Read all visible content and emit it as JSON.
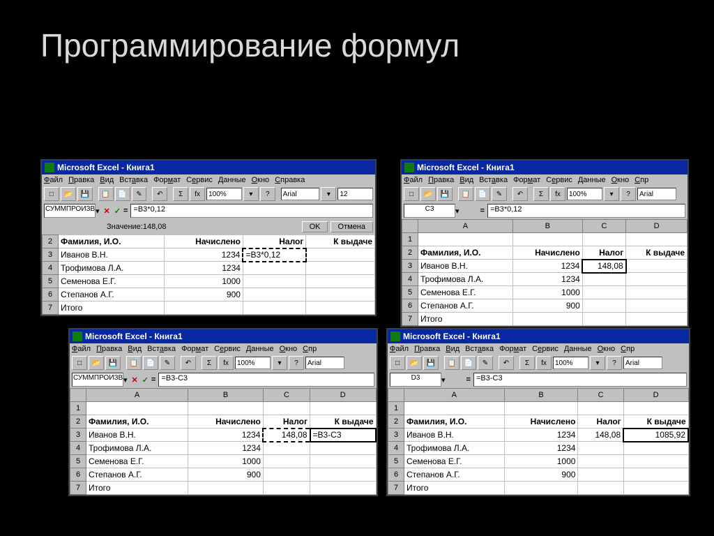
{
  "title": "Программирование формул",
  "app": "Microsoft Excel - Книга1",
  "menu": [
    "Файл",
    "Правка",
    "Вид",
    "Вставка",
    "Формат",
    "Сервис",
    "Данные",
    "Окно",
    "Справка"
  ],
  "underline": [
    "Ф",
    "П",
    "В",
    "",
    "",
    "",
    "Д",
    "О",
    "Спр"
  ],
  "zoom": "100%",
  "font": "Arial",
  "fsize": "12",
  "cols": [
    "A",
    "B",
    "C",
    "D"
  ],
  "headers": [
    "Фамилия, И.О.",
    "Начислено",
    "Налог",
    "К выдаче"
  ],
  "names": [
    "Иванов В.Н.",
    "Трофимова Л.А.",
    "Семенова Е.Г.",
    "Степанов А.Г.",
    "Итого"
  ],
  "vals": [
    "1234",
    "1234",
    "1000",
    "900"
  ],
  "w1": {
    "namebox": "СУММПРОИЗВ",
    "formula": "=B3*0,12",
    "valLabel": "Значение:148,08",
    "ok": "OK",
    "cancel": "Отмена",
    "c3": "=B3*0,12"
  },
  "w2": {
    "namebox": "C3",
    "formula": "=B3*0,12",
    "c3": "148,08"
  },
  "w3": {
    "namebox": "СУММПРОИЗВ",
    "formula": "=B3-C3",
    "c3": "148,08",
    "d3": "=B3-C3"
  },
  "w4": {
    "namebox": "D3",
    "formula": "=B3-C3",
    "c3": "148,08",
    "d3": "1085,92"
  }
}
